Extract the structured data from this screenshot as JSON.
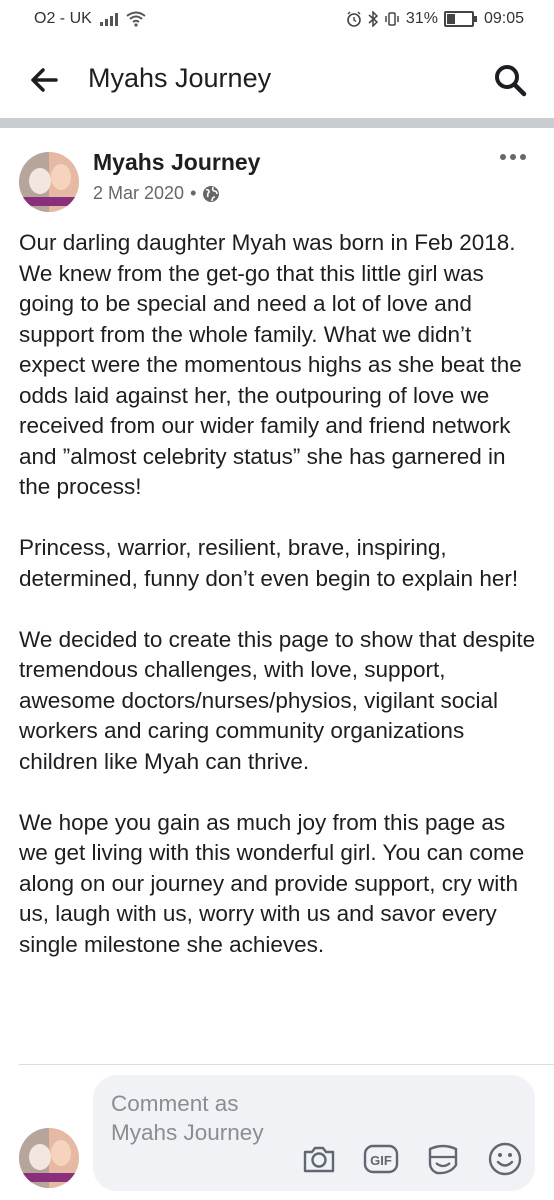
{
  "status_bar": {
    "carrier": "O2 - UK",
    "battery_percent": "31%",
    "time": "09:05"
  },
  "header": {
    "title": "Myahs Journey"
  },
  "post": {
    "author": "Myahs Journey",
    "date": "2 Mar 2020",
    "separator": "•",
    "privacy_icon": "globe-icon",
    "paragraphs": [
      "Our darling daughter Myah was born in Feb 2018.  We knew from the get-go that this little girl was going to be special and need a lot of love and support from the whole family.  What we didn’t expect were the momentous highs as she beat the odds laid against her, the outpouring of love we received from our wider family and friend network and ”almost celebrity status” she has garnered in the process!",
      "Princess, warrior, resilient, brave, inspiring, determined, funny don’t even begin to explain her!",
      "We decided to create this page to show that despite tremendous challenges, with love, support, awesome doctors/nurses/physios, vigilant social workers and caring community organizations children like Myah can thrive.",
      "We hope you gain as much joy from this page as we get living with this wonderful girl.  You can come along on our journey and provide support, cry with us, laugh with us, worry with us and savor every single milestone she achieves."
    ]
  },
  "comment_bar": {
    "placeholder": "Comment as Myahs Journey",
    "gif_label": "GIF",
    "icons": [
      "camera-icon",
      "gif-icon",
      "sticker-icon",
      "emoji-icon"
    ]
  },
  "colors": {
    "text": "#1c1e21",
    "secondary_text": "#65676b",
    "divider": "#c9ccd1",
    "comment_bg": "#f0f2f5"
  }
}
